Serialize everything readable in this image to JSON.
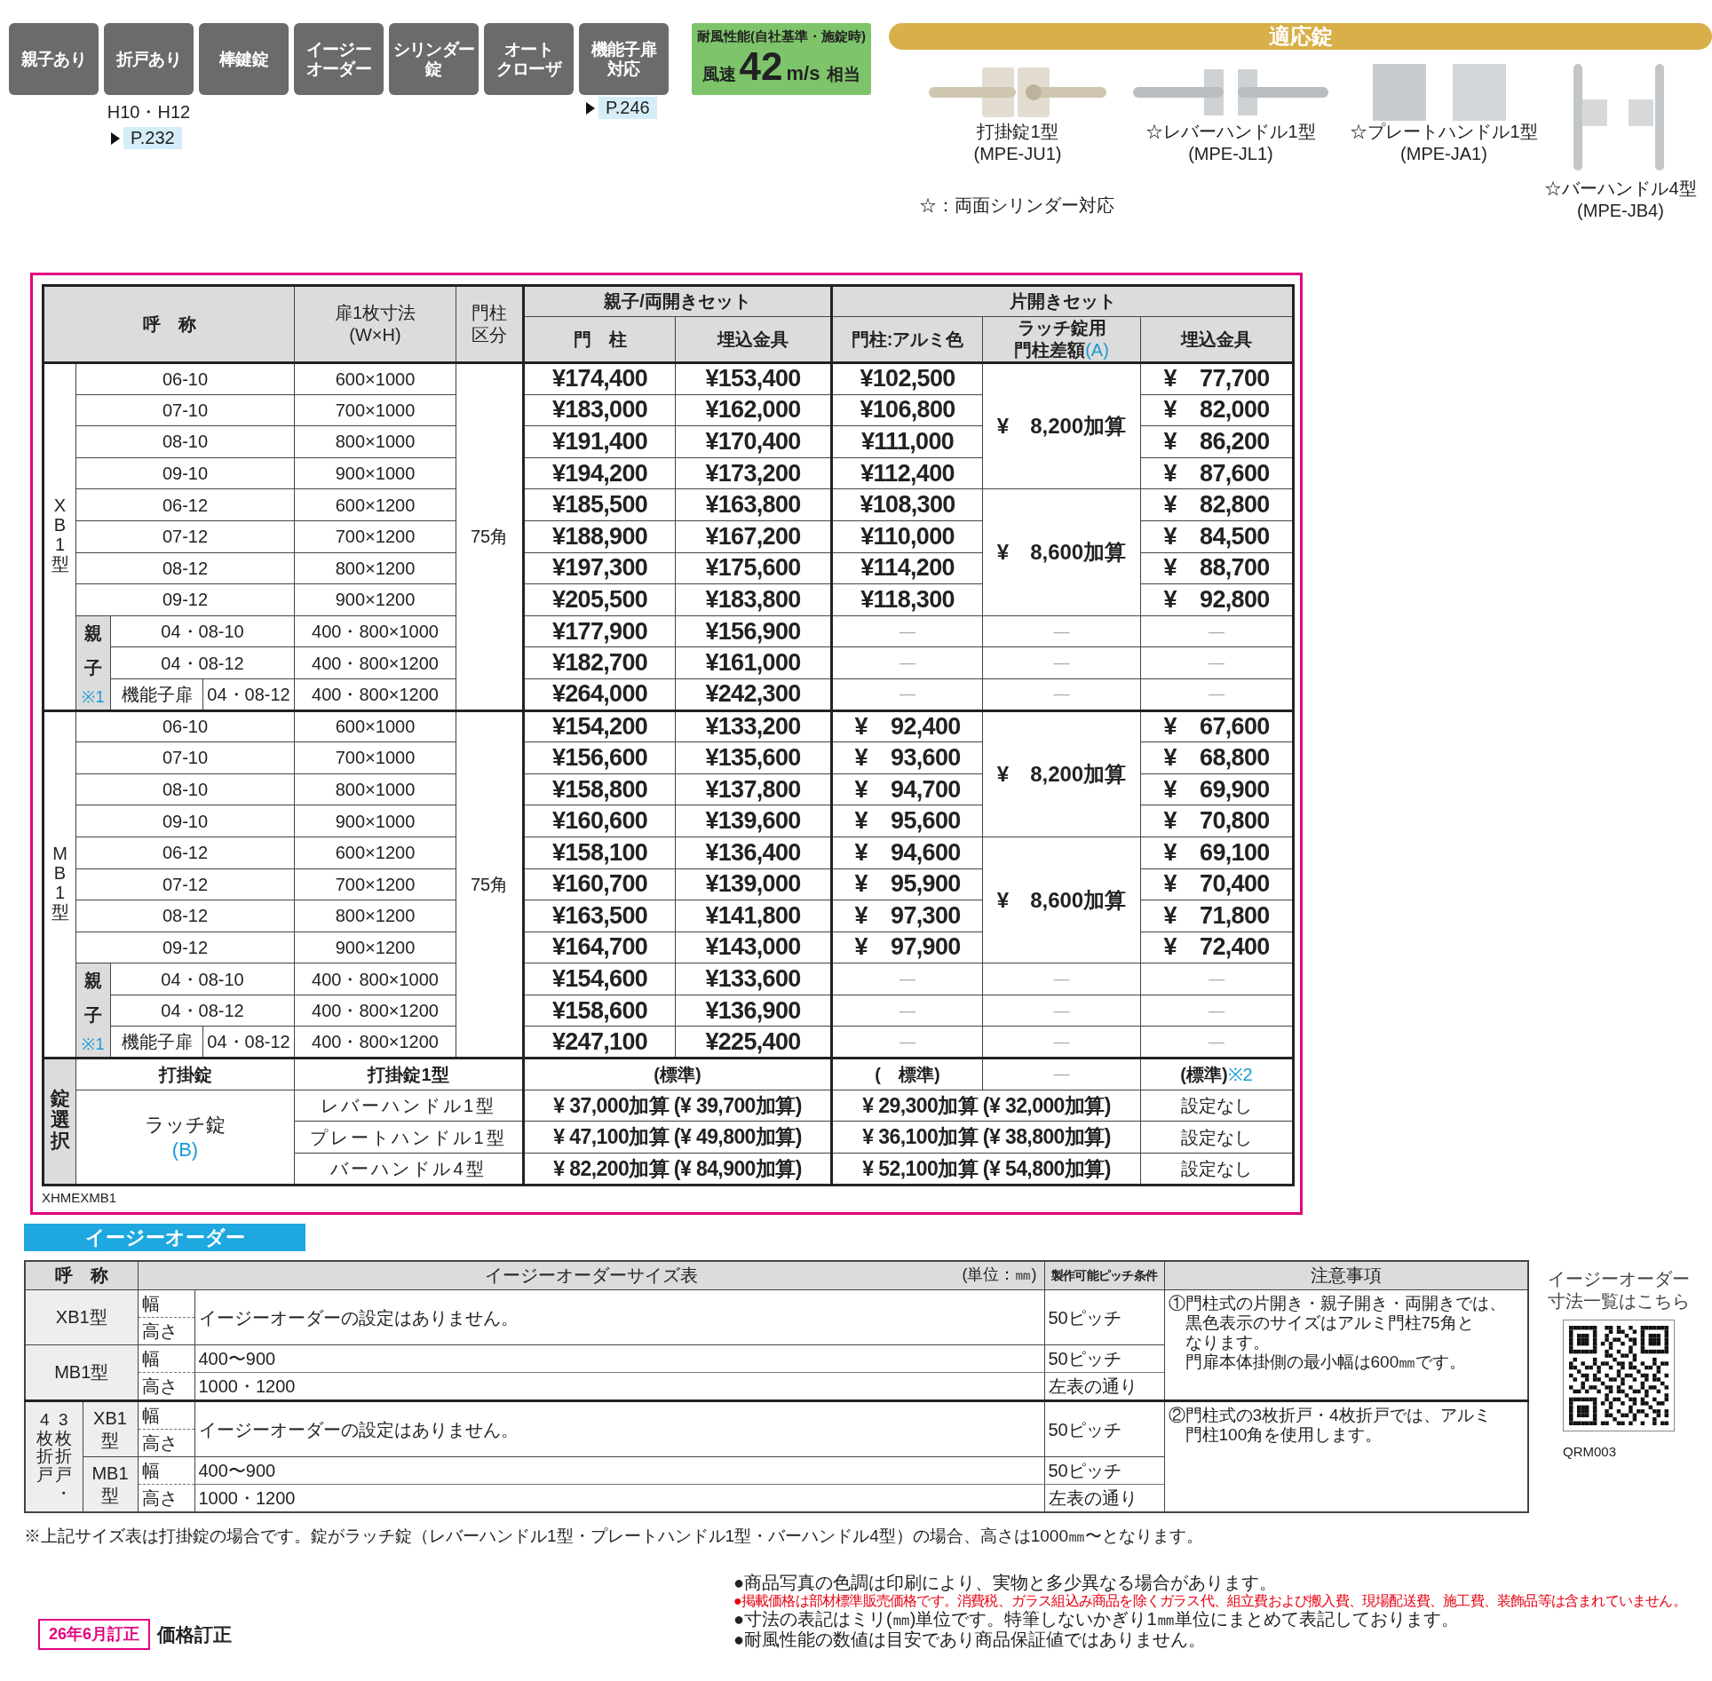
{
  "badges": [
    {
      "lines": [
        "親子あり"
      ]
    },
    {
      "lines": [
        "折戸あり"
      ],
      "note": "H10・H12",
      "page_ref": "P.232"
    },
    {
      "lines": [
        "棒鍵錠"
      ]
    },
    {
      "lines": [
        "イージー",
        "オーダー"
      ]
    },
    {
      "lines": [
        "シリンダー",
        "錠"
      ]
    },
    {
      "lines": [
        "オート",
        "クローザ"
      ]
    },
    {
      "lines": [
        "機能子扉",
        "対応"
      ],
      "page_ref": "P.246"
    }
  ],
  "wind": {
    "title": "耐風性能(自社基準・施錠時)",
    "prefix": "風速",
    "value": "42",
    "unit": "m/s",
    "suffix": "相当"
  },
  "locks": {
    "title": "適応錠",
    "items": [
      {
        "kind": "drop-latch",
        "name": "打掛錠1型",
        "code": "(MPE-JU1)"
      },
      {
        "kind": "lever",
        "name": "☆レバーハンドル1型",
        "code": "(MPE-JL1)"
      },
      {
        "kind": "plate",
        "name": "☆プレートハンドル1型",
        "code": "(MPE-JA1)"
      },
      {
        "kind": "bar",
        "name": "☆バーハンドル4型",
        "code": "(MPE-JB4)"
      }
    ],
    "note": "☆：両面シリンダー対応"
  },
  "price_table": {
    "header": {
      "name": "呼　称",
      "size": [
        "扉1枚寸法",
        "(W×H)"
      ],
      "post_class": [
        "門柱",
        "区分"
      ],
      "double_set": "親子/両開きセット",
      "single_set": "片開きセット",
      "post": "門　柱",
      "embed": "埋込金具",
      "alumi": "門柱:アルミ色",
      "latch": [
        "ラッチ錠用",
        "門柱差額"
      ],
      "latch_ref": "(A)",
      "single_embed": "埋込金具"
    },
    "groups": [
      {
        "label": "XB1型",
        "post_class": "75角",
        "sets": [
          {
            "latch_diff": "¥　8,200加算",
            "rows": [
              {
                "name": "06-10",
                "size": "600×1000",
                "post": "¥174,400",
                "embed": "¥153,400",
                "alumi": "¥102,500",
                "single_embed": "¥　77,700"
              },
              {
                "name": "07-10",
                "size": "700×1000",
                "post": "¥183,000",
                "embed": "¥162,000",
                "alumi": "¥106,800",
                "single_embed": "¥　82,000"
              },
              {
                "name": "08-10",
                "size": "800×1000",
                "post": "¥191,400",
                "embed": "¥170,400",
                "alumi": "¥111,000",
                "single_embed": "¥　86,200"
              },
              {
                "name": "09-10",
                "size": "900×1000",
                "post": "¥194,200",
                "embed": "¥173,200",
                "alumi": "¥112,400",
                "single_embed": "¥　87,600"
              }
            ]
          },
          {
            "latch_diff": "¥　8,600加算",
            "rows": [
              {
                "name": "06-12",
                "size": "600×1200",
                "post": "¥185,500",
                "embed": "¥163,800",
                "alumi": "¥108,300",
                "single_embed": "¥　82,800"
              },
              {
                "name": "07-12",
                "size": "700×1200",
                "post": "¥188,900",
                "embed": "¥167,200",
                "alumi": "¥110,000",
                "single_embed": "¥　84,500"
              },
              {
                "name": "08-12",
                "size": "800×1200",
                "post": "¥197,300",
                "embed": "¥175,600",
                "alumi": "¥114,200",
                "single_embed": "¥　88,700"
              },
              {
                "name": "09-12",
                "size": "900×1200",
                "post": "¥205,500",
                "embed": "¥183,800",
                "alumi": "¥118,300",
                "single_embed": "¥　92,800"
              }
            ]
          }
        ],
        "oyako": {
          "top": "親",
          "bottom": "子",
          "note": "※1",
          "rows": [
            {
              "kind": "pair",
              "name": "04・08-10",
              "size": "400・800×1000",
              "post": "¥177,900",
              "embed": "¥156,900",
              "alumi": "—",
              "latch": "—",
              "single_embed": "—"
            },
            {
              "kind": "pair",
              "name": "04・08-12",
              "size": "400・800×1200",
              "post": "¥182,700",
              "embed": "¥161,000",
              "alumi": "—",
              "latch": "—",
              "single_embed": "—"
            },
            {
              "kind": "function",
              "type_label": "機能子扉",
              "name": "04・08-12",
              "size": "400・800×1200",
              "post": "¥264,000",
              "embed": "¥242,300",
              "alumi": "—",
              "latch": "—",
              "single_embed": "—"
            }
          ]
        }
      },
      {
        "label": "MB1型",
        "post_class": "75角",
        "sets": [
          {
            "latch_diff": "¥　8,200加算",
            "rows": [
              {
                "name": "06-10",
                "size": "600×1000",
                "post": "¥154,200",
                "embed": "¥133,200",
                "alumi": "¥　92,400",
                "single_embed": "¥　67,600"
              },
              {
                "name": "07-10",
                "size": "700×1000",
                "post": "¥156,600",
                "embed": "¥135,600",
                "alumi": "¥　93,600",
                "single_embed": "¥　68,800"
              },
              {
                "name": "08-10",
                "size": "800×1000",
                "post": "¥158,800",
                "embed": "¥137,800",
                "alumi": "¥　94,700",
                "single_embed": "¥　69,900"
              },
              {
                "name": "09-10",
                "size": "900×1000",
                "post": "¥160,600",
                "embed": "¥139,600",
                "alumi": "¥　95,600",
                "single_embed": "¥　70,800"
              }
            ]
          },
          {
            "latch_diff": "¥　8,600加算",
            "rows": [
              {
                "name": "06-12",
                "size": "600×1200",
                "post": "¥158,100",
                "embed": "¥136,400",
                "alumi": "¥　94,600",
                "single_embed": "¥　69,100"
              },
              {
                "name": "07-12",
                "size": "700×1200",
                "post": "¥160,700",
                "embed": "¥139,000",
                "alumi": "¥　95,900",
                "single_embed": "¥　70,400"
              },
              {
                "name": "08-12",
                "size": "800×1200",
                "post": "¥163,500",
                "embed": "¥141,800",
                "alumi": "¥　97,300",
                "single_embed": "¥　71,800"
              },
              {
                "name": "09-12",
                "size": "900×1200",
                "post": "¥164,700",
                "embed": "¥143,000",
                "alumi": "¥　97,900",
                "single_embed": "¥　72,400"
              }
            ]
          }
        ],
        "oyako": {
          "top": "親",
          "bottom": "子",
          "note": "※1",
          "rows": [
            {
              "kind": "pair",
              "name": "04・08-10",
              "size": "400・800×1000",
              "post": "¥154,600",
              "embed": "¥133,600",
              "alumi": "—",
              "latch": "—",
              "single_embed": "—"
            },
            {
              "kind": "pair",
              "name": "04・08-12",
              "size": "400・800×1200",
              "post": "¥158,600",
              "embed": "¥136,900",
              "alumi": "—",
              "latch": "—",
              "single_embed": "—"
            },
            {
              "kind": "function",
              "type_label": "機能子扉",
              "name": "04・08-12",
              "size": "400・800×1200",
              "post": "¥247,100",
              "embed": "¥225,400",
              "alumi": "—",
              "latch": "—",
              "single_embed": "—"
            }
          ]
        }
      }
    ],
    "lock_selection": {
      "label": "錠選択",
      "drop": {
        "type": "打掛錠",
        "model": "打掛錠1型",
        "double": "(標準)",
        "alumi": "(　標準)",
        "latch": "—",
        "single_embed": "(標準)",
        "note": "※2"
      },
      "latch": {
        "type": "ラッチ錠",
        "ref": "(B)",
        "rows": [
          {
            "model": "レバーハンドル1型",
            "double": "¥ 37,000加算 (¥ 39,700加算)",
            "single": "¥ 29,300加算 (¥ 32,000加算)",
            "single_embed": "設定なし"
          },
          {
            "model": "プレートハンドル1型",
            "double": "¥ 47,100加算 (¥ 49,800加算)",
            "single": "¥ 36,100加算 (¥ 38,800加算)",
            "single_embed": "設定なし"
          },
          {
            "model": "バーハンドル4型",
            "double": "¥ 82,200加算 (¥ 84,900加算)",
            "single": "¥ 52,100加算 (¥ 54,800加算)",
            "single_embed": "設定なし"
          }
        ]
      }
    },
    "code": "XHMEXMB1"
  },
  "easy_order": {
    "title": "イージーオーダー",
    "header": {
      "name": "呼　称",
      "size_table": "イージーオーダーサイズ表",
      "unit": "(単位：㎜)",
      "pitch": "製作可能ピッチ条件",
      "notes": "注意事項"
    },
    "sections": [
      {
        "note": [
          "①門柱式の片開き・親子開き・両開きでは、",
          "黒色表示のサイズはアルミ門柱75角と",
          "なります。",
          "門扉本体掛側の最小幅は600㎜です。"
        ],
        "models": [
          {
            "name": [
              "XB1型"
            ],
            "kind": "none",
            "width_label": "幅",
            "height_label": "高さ",
            "message": "イージーオーダーの設定はありません。",
            "pitch": "50ピッチ"
          },
          {
            "name": [
              "MB1型"
            ],
            "kind": "range",
            "width_label": "幅",
            "width": "400〜900",
            "width_pitch": "50ピッチ",
            "height_label": "高さ",
            "height": "1000・1200",
            "height_pitch": "左表の通り"
          }
        ]
      },
      {
        "group_label": [
          "4枚折戸",
          "3枚折戸・"
        ],
        "note": [
          "②門柱式の3枚折戸・4枚折戸では、アルミ",
          "門柱100角を使用します。"
        ],
        "models": [
          {
            "name": [
              "XB1",
              "型"
            ],
            "kind": "none",
            "width_label": "幅",
            "height_label": "高さ",
            "message": "イージーオーダーの設定はありません。",
            "pitch": "50ピッチ"
          },
          {
            "name": [
              "MB1",
              "型"
            ],
            "kind": "range",
            "width_label": "幅",
            "width": "400〜900",
            "width_pitch": "50ピッチ",
            "height_label": "高さ",
            "height": "1000・1200",
            "height_pitch": "左表の通り"
          }
        ]
      }
    ],
    "qr": {
      "caption": [
        "イージーオーダー",
        "寸法一覧はこちら"
      ],
      "code": "QRM003"
    }
  },
  "footnote": "※上記サイズ表は打掛錠の場合です。錠がラッチ錠（レバーハンドル1型・プレートハンドル1型・バーハンドル4型）の場合、高さは1000㎜〜となります。",
  "revision": {
    "badge": "26年6月訂正",
    "label": "価格訂正"
  },
  "notes": [
    {
      "kind": "normal",
      "text": "●商品写真の色調は印刷により、実物と多少異なる場合があります。"
    },
    {
      "kind": "warning",
      "text": "●掲載価格は部材標準販売価格です。消費税、ガラス組込み商品を除くガラス代、組立費および搬入費、現場配送費、施工費、装飾品等は含まれていません。"
    },
    {
      "kind": "normal",
      "text": "●寸法の表記はミリ(㎜)単位です。特筆しないかぎり1㎜単位にまとめて表記しております。"
    },
    {
      "kind": "normal",
      "text": "●耐風性能の数値は目安であり商品保証値ではありません。"
    }
  ]
}
